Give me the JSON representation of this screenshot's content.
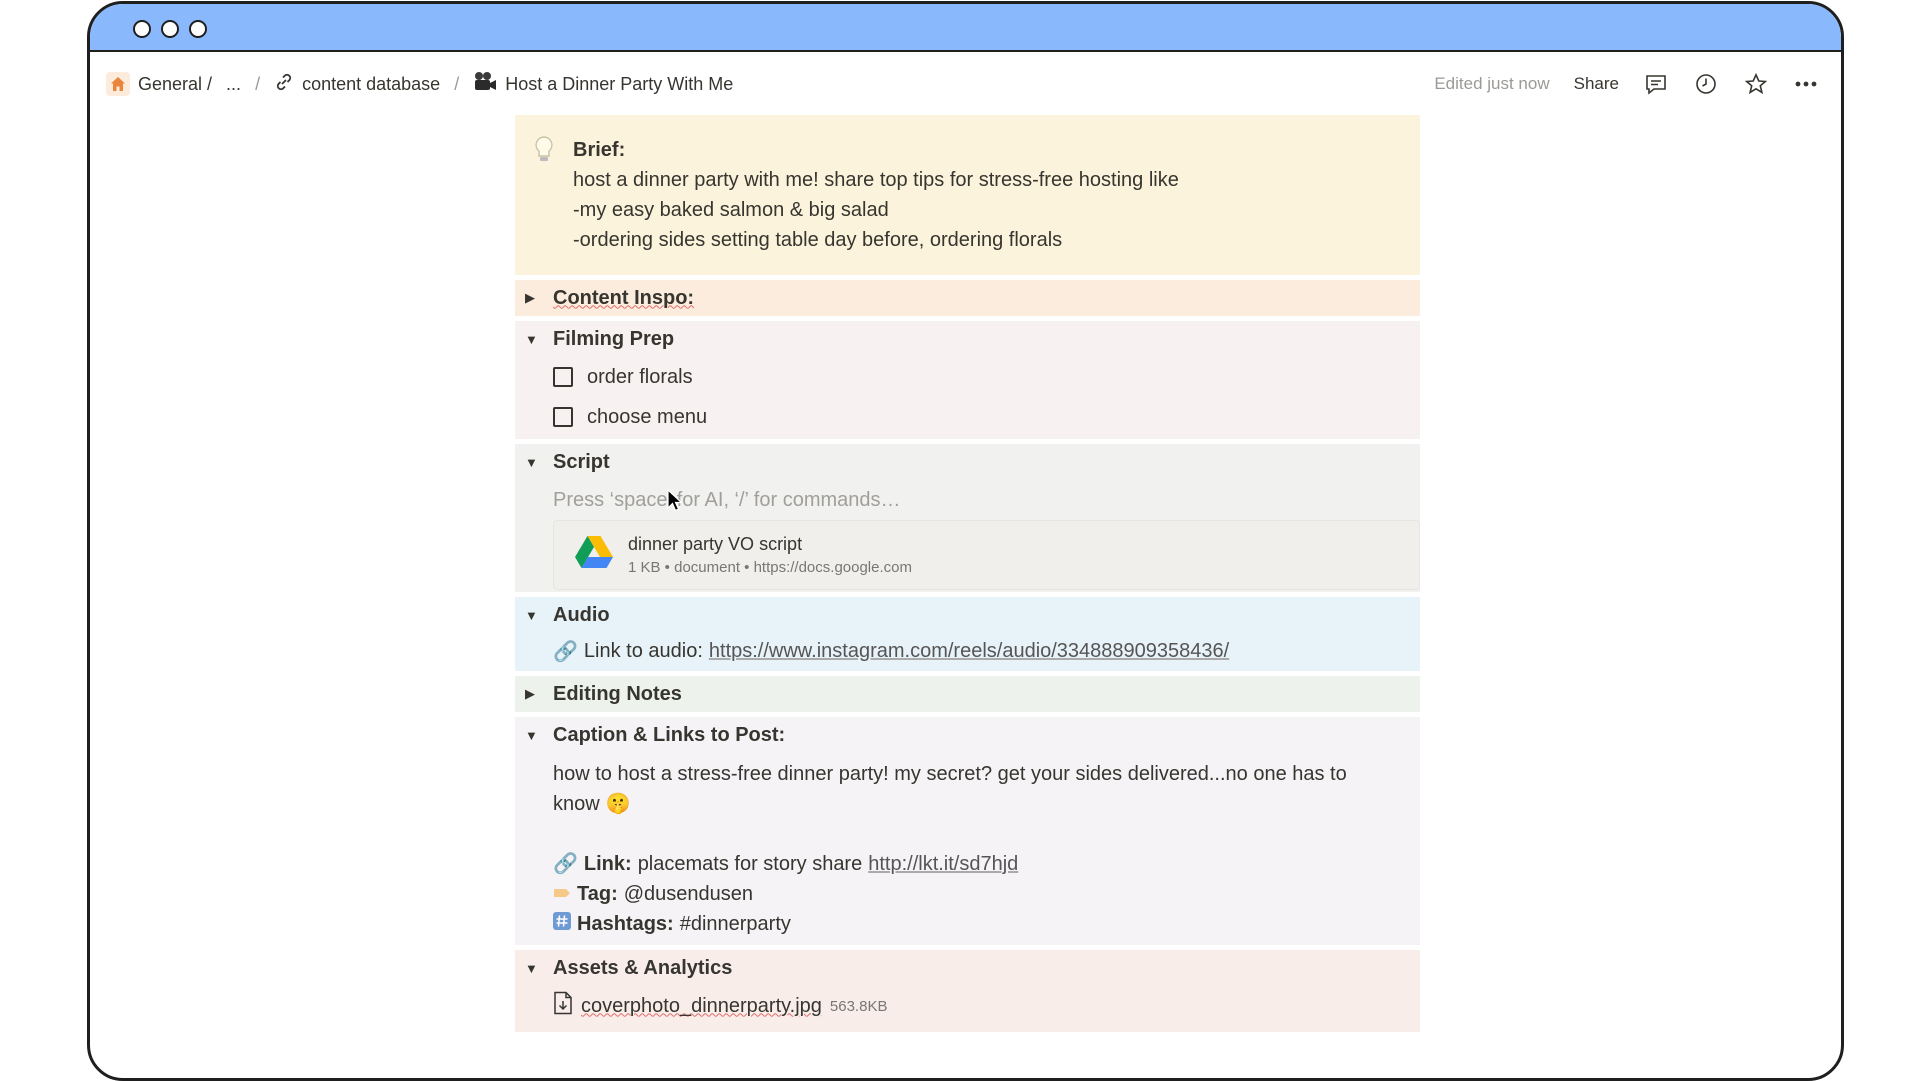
{
  "colors": {
    "titlebar": "#8ab8fd",
    "callout_bg": "#fbf3dc",
    "inspo_bg": "#fbecdd",
    "filming_bg": "#f8f1f1",
    "script_bg": "#f1f1ef",
    "audio_bg": "#e7f3f8",
    "editing_bg": "#edf3ec",
    "caption_bg": "#f5f3f6",
    "assets_bg": "#f8ede9"
  },
  "breadcrumb": {
    "general": "General /",
    "ellipsis": "...",
    "slash": "/",
    "database": "content database",
    "page": "Host a Dinner Party With Me"
  },
  "toolbar": {
    "edited": "Edited just now",
    "share": "Share",
    "icons": [
      "comment-icon",
      "clock-icon",
      "star-icon",
      "more-icon"
    ]
  },
  "brief": {
    "label": "Brief:",
    "lines": [
      "host a dinner party with me! share top tips for stress-free hosting like",
      "-my easy baked salmon & big salad",
      "-ordering sides setting table day before, ordering florals"
    ]
  },
  "sections": {
    "inspo": {
      "title": "Content Inspo:",
      "expanded": false
    },
    "filming": {
      "title": "Filming Prep",
      "expanded": true,
      "todos": [
        {
          "label": "order florals",
          "checked": false
        },
        {
          "label": "choose menu",
          "checked": false
        }
      ]
    },
    "script": {
      "title": "Script",
      "expanded": true,
      "placeholder": "Press ‘space’ for AI, ‘/’ for commands…",
      "file_title": "dinner party VO script",
      "file_meta": "1 KB • document • https://docs.google.com"
    },
    "audio": {
      "title": "Audio",
      "expanded": true,
      "label": "Link to audio:",
      "url": "https://www.instagram.com/reels/audio/334888909358436/"
    },
    "editing": {
      "title": "Editing Notes",
      "expanded": false
    },
    "caption": {
      "title": "Caption & Links to Post:",
      "expanded": true,
      "text_line1": "how to host a stress-free dinner party! my secret? get your sides delivered...no one has to",
      "text_line2": "know",
      "link_label": "Link:",
      "link_text": "placemats for story share",
      "link_url": "http://lkt.it/sd7hjd",
      "tag_label": "Tag:",
      "tag_value": "@dusendusen",
      "hashtags_label": "Hashtags:",
      "hashtags_value": "#dinnerparty"
    },
    "assets": {
      "title": "Assets & Analytics",
      "expanded": true,
      "file_name": "coverphoto_dinnerparty.jpg",
      "file_size": "563.8KB"
    }
  }
}
